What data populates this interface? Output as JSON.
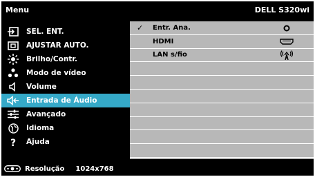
{
  "header": {
    "title": "Menu",
    "model": "DELL S320wi"
  },
  "menu": {
    "items": [
      {
        "label": "SEL. ENT.",
        "icon": "input-select-icon"
      },
      {
        "label": "AJUSTAR AUTO.",
        "icon": "auto-adjust-icon"
      },
      {
        "label": "Brilho/Contr.",
        "icon": "brightness-icon"
      },
      {
        "label": "Modo de vídeo",
        "icon": "video-mode-icon"
      },
      {
        "label": "Volume",
        "icon": "volume-icon"
      },
      {
        "label": "Entrada de Áudio",
        "icon": "audio-input-icon"
      },
      {
        "label": "Avançado",
        "icon": "advanced-icon"
      },
      {
        "label": "Idioma",
        "icon": "language-icon"
      },
      {
        "label": "Ajuda",
        "icon": "help-icon"
      }
    ],
    "selected_index": 5
  },
  "submenu": {
    "options": [
      {
        "label": "Entr. Ana.",
        "checked": true,
        "icon": "analog-jack-icon"
      },
      {
        "label": "HDMI",
        "checked": false,
        "icon": "hdmi-icon"
      },
      {
        "label": "LAN s/fio",
        "checked": false,
        "icon": "wireless-icon"
      }
    ],
    "check_mark": "✓"
  },
  "status": {
    "label": "Resolução",
    "value": "1024x768",
    "icon": "resolution-icon"
  },
  "colors": {
    "background": "#000000",
    "selection": "#35a9c8",
    "panel": "#b8b8b8",
    "text": "#ffffff"
  }
}
